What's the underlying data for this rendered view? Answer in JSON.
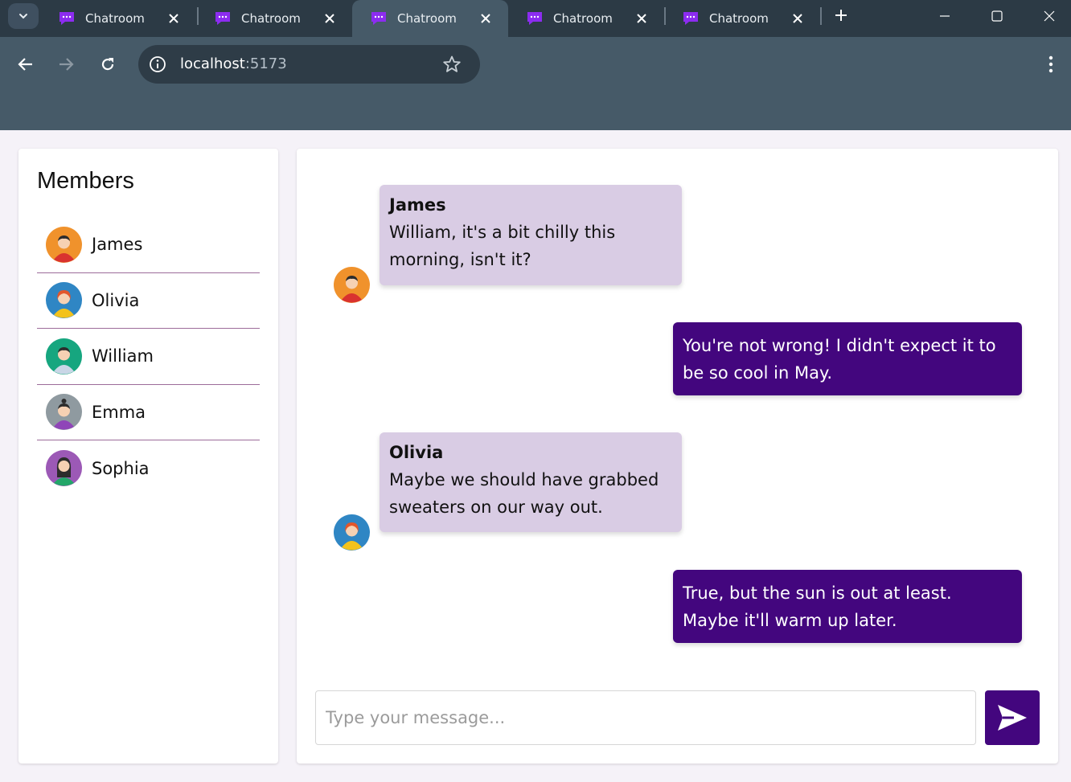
{
  "browser": {
    "tabs": [
      {
        "title": "Chatroom",
        "active": false
      },
      {
        "title": "Chatroom",
        "active": false
      },
      {
        "title": "Chatroom",
        "active": true
      },
      {
        "title": "Chatroom",
        "active": false
      },
      {
        "title": "Chatroom",
        "active": false
      }
    ],
    "address": {
      "host": "localhost",
      "port": ":5173"
    }
  },
  "members": {
    "heading": "Members",
    "items": [
      {
        "name": "James",
        "avatar_color": "#f0922c"
      },
      {
        "name": "Olivia",
        "avatar_color": "#2f86c4"
      },
      {
        "name": "William",
        "avatar_color": "#16a67f"
      },
      {
        "name": "Emma",
        "avatar_color": "#8f9aa0"
      },
      {
        "name": "Sophia",
        "avatar_color": "#9c59b6"
      }
    ]
  },
  "chat": {
    "messages": [
      {
        "sender": "James",
        "text": "William, it's a bit chilly this morning, isn't it?",
        "direction": "incoming"
      },
      {
        "sender": "",
        "text": "You're not wrong! I didn't expect it to be so cool in May.",
        "direction": "outgoing"
      },
      {
        "sender": "Olivia",
        "text": "Maybe we should have grabbed sweaters on our way out.",
        "direction": "incoming"
      },
      {
        "sender": "",
        "text": "True, but the sun is out at least. Maybe it'll warm up later.",
        "direction": "outgoing"
      }
    ],
    "composer": {
      "placeholder": "Type your message...",
      "value": ""
    },
    "send_icon": "send-icon"
  },
  "colors": {
    "accent": "#43067e",
    "incoming_bubble": "#d9cce4",
    "browser_frame": "#2c3a45",
    "toolbar": "#465a68",
    "page_background": "#f5f2f8"
  }
}
